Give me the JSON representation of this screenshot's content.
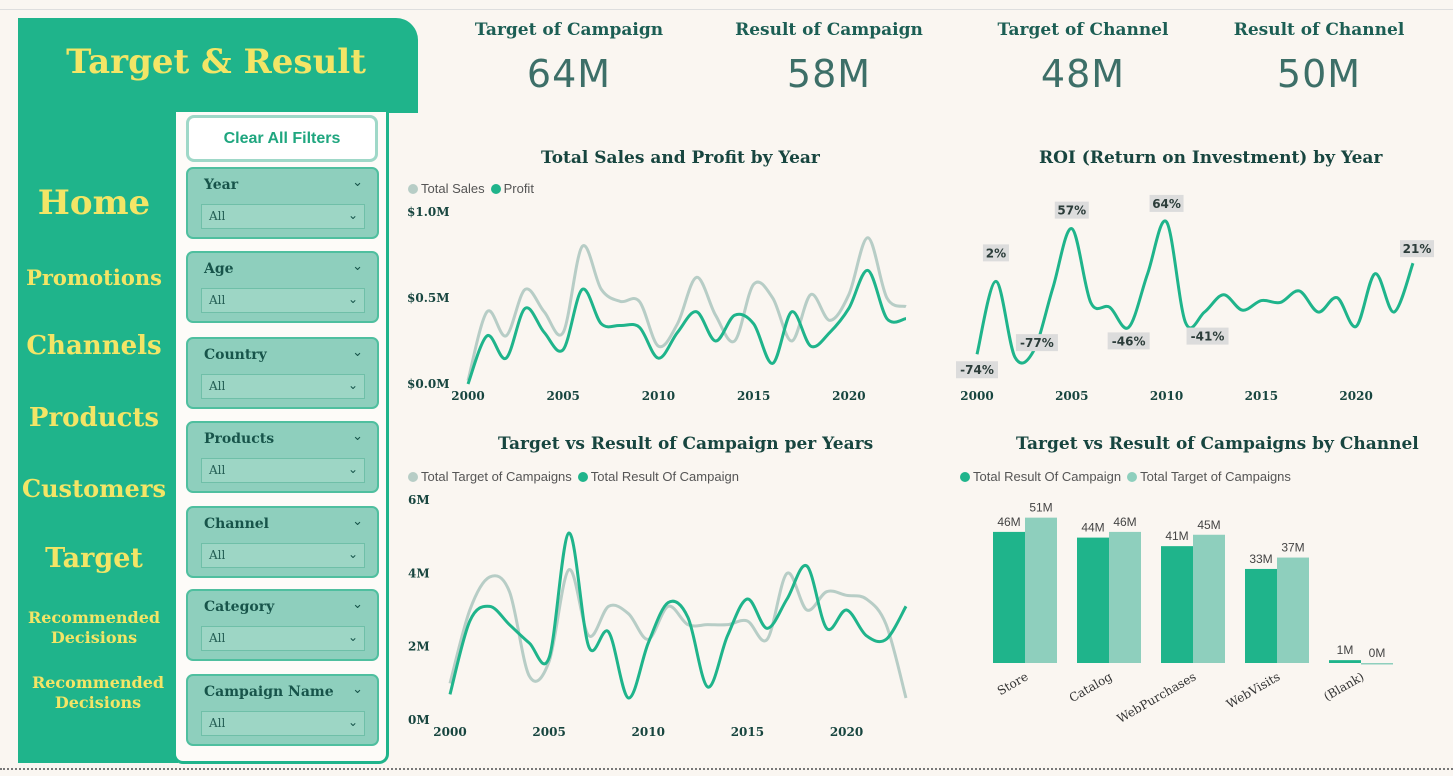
{
  "nav": {
    "title": "Target & Result",
    "items": [
      "Home",
      "Promotions",
      "Channels",
      "Products",
      "Customers",
      "Target",
      "Recommended\nDecisions",
      "Recommended\nDecisions"
    ]
  },
  "filters": {
    "clear_label": "Clear All Filters",
    "slicers": [
      {
        "label": "Year",
        "value": "All"
      },
      {
        "label": "Age",
        "value": "All"
      },
      {
        "label": "Country",
        "value": "All"
      },
      {
        "label": "Products",
        "value": "All"
      },
      {
        "label": "Channel",
        "value": "All"
      },
      {
        "label": "Category",
        "value": "All"
      },
      {
        "label": "Campaign Name",
        "value": "All"
      }
    ]
  },
  "kpis": [
    {
      "label": "Target of Campaign",
      "value": "64M"
    },
    {
      "label": "Result of Campaign",
      "value": "58M"
    },
    {
      "label": "Target of Channel",
      "value": "48M"
    },
    {
      "label": "Result of Channel",
      "value": "50M"
    }
  ],
  "colors": {
    "accent": "#1fb48b",
    "light": "#b7cdc6",
    "bar_light": "#8ecfbd",
    "nav_text": "#f3e566"
  },
  "chart_data": [
    {
      "type": "line",
      "title": "Total Sales and Profit by Year",
      "x": [
        2000,
        2001,
        2002,
        2003,
        2004,
        2005,
        2006,
        2007,
        2008,
        2009,
        2010,
        2011,
        2012,
        2013,
        2014,
        2015,
        2016,
        2017,
        2018,
        2019,
        2020,
        2021,
        2022,
        2023
      ],
      "x_ticks": [
        "2000",
        "2005",
        "2010",
        "2015",
        "2020"
      ],
      "y_ticks": [
        "$0.0M",
        "$0.5M",
        "$1.0M"
      ],
      "ylim": [
        0,
        1.0
      ],
      "series": [
        {
          "name": "Total Sales",
          "color": "#b7cdc6",
          "values": [
            0.02,
            0.42,
            0.28,
            0.55,
            0.42,
            0.3,
            0.8,
            0.55,
            0.48,
            0.48,
            0.22,
            0.35,
            0.62,
            0.4,
            0.25,
            0.58,
            0.5,
            0.25,
            0.52,
            0.37,
            0.52,
            0.85,
            0.5,
            0.45
          ]
        },
        {
          "name": "Profit",
          "color": "#1fb48b",
          "values": [
            0.0,
            0.28,
            0.15,
            0.44,
            0.3,
            0.2,
            0.55,
            0.35,
            0.34,
            0.33,
            0.15,
            0.3,
            0.42,
            0.25,
            0.4,
            0.35,
            0.12,
            0.42,
            0.22,
            0.3,
            0.44,
            0.66,
            0.38,
            0.38
          ]
        }
      ]
    },
    {
      "type": "line",
      "title": "ROI (Return on Investment) by Year",
      "x": [
        2000,
        2001,
        2002,
        2003,
        2004,
        2005,
        2006,
        2007,
        2008,
        2009,
        2010,
        2011,
        2012,
        2013,
        2014,
        2015,
        2016,
        2017,
        2018,
        2019,
        2020,
        2021,
        2022,
        2023
      ],
      "x_ticks": [
        "2000",
        "2005",
        "2010",
        "2015",
        "2020"
      ],
      "series": [
        {
          "name": "ROI",
          "color": "#1fb48b",
          "values": [
            -74,
            2,
            -77,
            -70,
            -5,
            57,
            -20,
            -25,
            -46,
            10,
            64,
            -41,
            -30,
            -12,
            -28,
            -18,
            -20,
            -8,
            -30,
            -15,
            -45,
            10,
            -30,
            21
          ]
        }
      ],
      "data_labels": [
        {
          "x": 2000,
          "text": "-74%"
        },
        {
          "x": 2001,
          "text": "2%"
        },
        {
          "x": 2002,
          "text": "-77%"
        },
        {
          "x": 2005,
          "text": "57%"
        },
        {
          "x": 2008,
          "text": "-46%"
        },
        {
          "x": 2010,
          "text": "64%"
        },
        {
          "x": 2011,
          "text": "-41%"
        },
        {
          "x": 2023,
          "text": "21%"
        }
      ]
    },
    {
      "type": "line",
      "title": "Target vs Result of Campaign per Years",
      "x": [
        2000,
        2001,
        2002,
        2003,
        2004,
        2005,
        2006,
        2007,
        2008,
        2009,
        2010,
        2011,
        2012,
        2013,
        2014,
        2015,
        2016,
        2017,
        2018,
        2019,
        2020,
        2021,
        2022,
        2023
      ],
      "x_ticks": [
        "2000",
        "2005",
        "2010",
        "2015",
        "2020"
      ],
      "y_ticks": [
        "0M",
        "2M",
        "4M",
        "6M"
      ],
      "ylim": [
        0,
        6
      ],
      "series": [
        {
          "name": "Total Target of Campaigns",
          "color": "#b7cdc6",
          "values": [
            1.0,
            3.0,
            3.9,
            3.5,
            1.2,
            1.6,
            4.1,
            2.3,
            3.1,
            2.9,
            2.2,
            3.1,
            2.6,
            2.6,
            2.6,
            2.7,
            2.2,
            4.0,
            3.0,
            3.5,
            3.4,
            3.3,
            2.6,
            0.6
          ]
        },
        {
          "name": "Total Result Of Campaign",
          "color": "#1fb48b",
          "values": [
            0.7,
            2.7,
            3.1,
            2.6,
            2.1,
            1.7,
            5.1,
            2.0,
            2.4,
            0.6,
            2.1,
            3.2,
            2.8,
            0.9,
            2.3,
            3.3,
            2.5,
            3.3,
            4.2,
            2.5,
            3.0,
            2.3,
            2.2,
            3.1
          ]
        }
      ]
    },
    {
      "type": "bar",
      "title": "Target vs Result of Campaigns by Channel",
      "categories": [
        "Store",
        "Catalog",
        "WebPurchases",
        "WebVisits",
        "(Blank)"
      ],
      "series": [
        {
          "name": "Total Result Of Campaign",
          "color": "#1fb48b",
          "values": [
            46,
            44,
            41,
            33,
            1
          ],
          "labels": [
            "46M",
            "44M",
            "41M",
            "33M",
            "1M"
          ]
        },
        {
          "name": "Total Target of Campaigns",
          "color": "#8ecfbd",
          "values": [
            51,
            46,
            45,
            37,
            0
          ],
          "labels": [
            "51M",
            "46M",
            "45M",
            "37M",
            "0M"
          ]
        }
      ]
    }
  ]
}
